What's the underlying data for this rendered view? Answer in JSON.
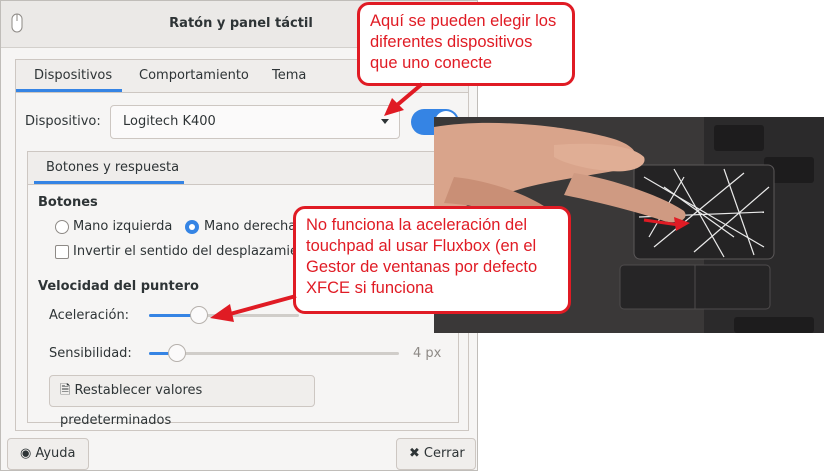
{
  "window": {
    "title": "Ratón y panel táctil"
  },
  "tabs": [
    {
      "label": "Dispositivos",
      "active": true
    },
    {
      "label": "Comportamiento",
      "active": false
    },
    {
      "label": "Tema",
      "active": false
    }
  ],
  "device": {
    "label": "Dispositivo:",
    "selected": "Logitech K400",
    "enabled": true
  },
  "inner_tabs": [
    {
      "label": "Botones y respuesta",
      "active": true
    }
  ],
  "buttons_section": {
    "title": "Botones",
    "left_hand": "Mano izquierda",
    "right_hand": "Mano derecha",
    "right_hand_selected": true,
    "reverse_scroll": "Invertir el sentido del desplazamiento",
    "reverse_scroll_checked": false
  },
  "pointer_speed": {
    "title": "Velocidad del puntero",
    "acceleration_label": "Aceleración:",
    "acceleration_fraction": 0.2,
    "sensitivity_label": "Sensibilidad:",
    "sensitivity_value": "4 px",
    "sensitivity_fraction": 0.11
  },
  "reset_button": "Restablecer valores predeterminados",
  "footer": {
    "help": "Ayuda",
    "close": "Cerrar"
  },
  "annotations": {
    "top": [
      "Aquí se pueden elegir los",
      "diferentes dispositivos",
      "que uno conecte"
    ],
    "middle": [
      "No funciona la aceleración del",
      "touchpad al usar Fluxbox (en el",
      "Gestor de ventanas por defecto",
      "XFCE si funciona"
    ]
  },
  "colors": {
    "accent": "#3584e4",
    "annotation": "#e01b24"
  }
}
